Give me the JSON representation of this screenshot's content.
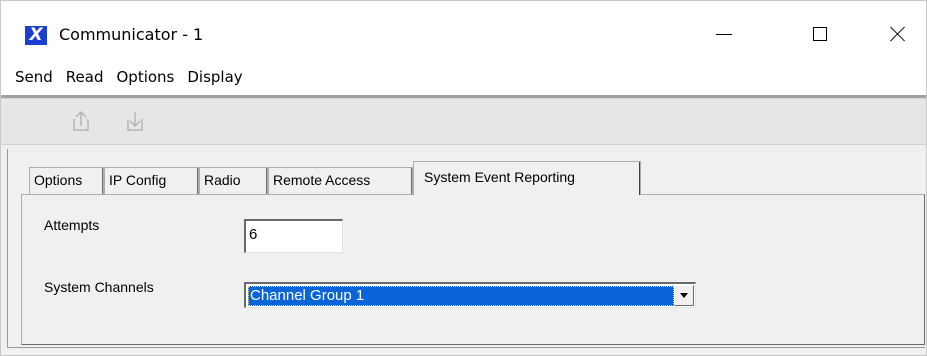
{
  "window": {
    "title": "Communicator - 1",
    "logo_glyph": "X",
    "logo_color": "#1a3fcf"
  },
  "menu": {
    "items": [
      "Send",
      "Read",
      "Options",
      "Display"
    ]
  },
  "toolbar": {
    "buttons": [
      {
        "icon": "send-upload-icon",
        "enabled": false
      },
      {
        "icon": "read-download-icon",
        "enabled": false
      }
    ]
  },
  "tabs": {
    "items": [
      "Options",
      "IP Config",
      "Radio",
      "Remote Access",
      "System Event Reporting"
    ],
    "active": "System Event Reporting"
  },
  "form": {
    "attempts_label": "Attempts",
    "attempts_value": "6",
    "channels_label": "System Channels",
    "channels_value": "Channel Group 1",
    "highlight_color": "#0a64d9"
  }
}
